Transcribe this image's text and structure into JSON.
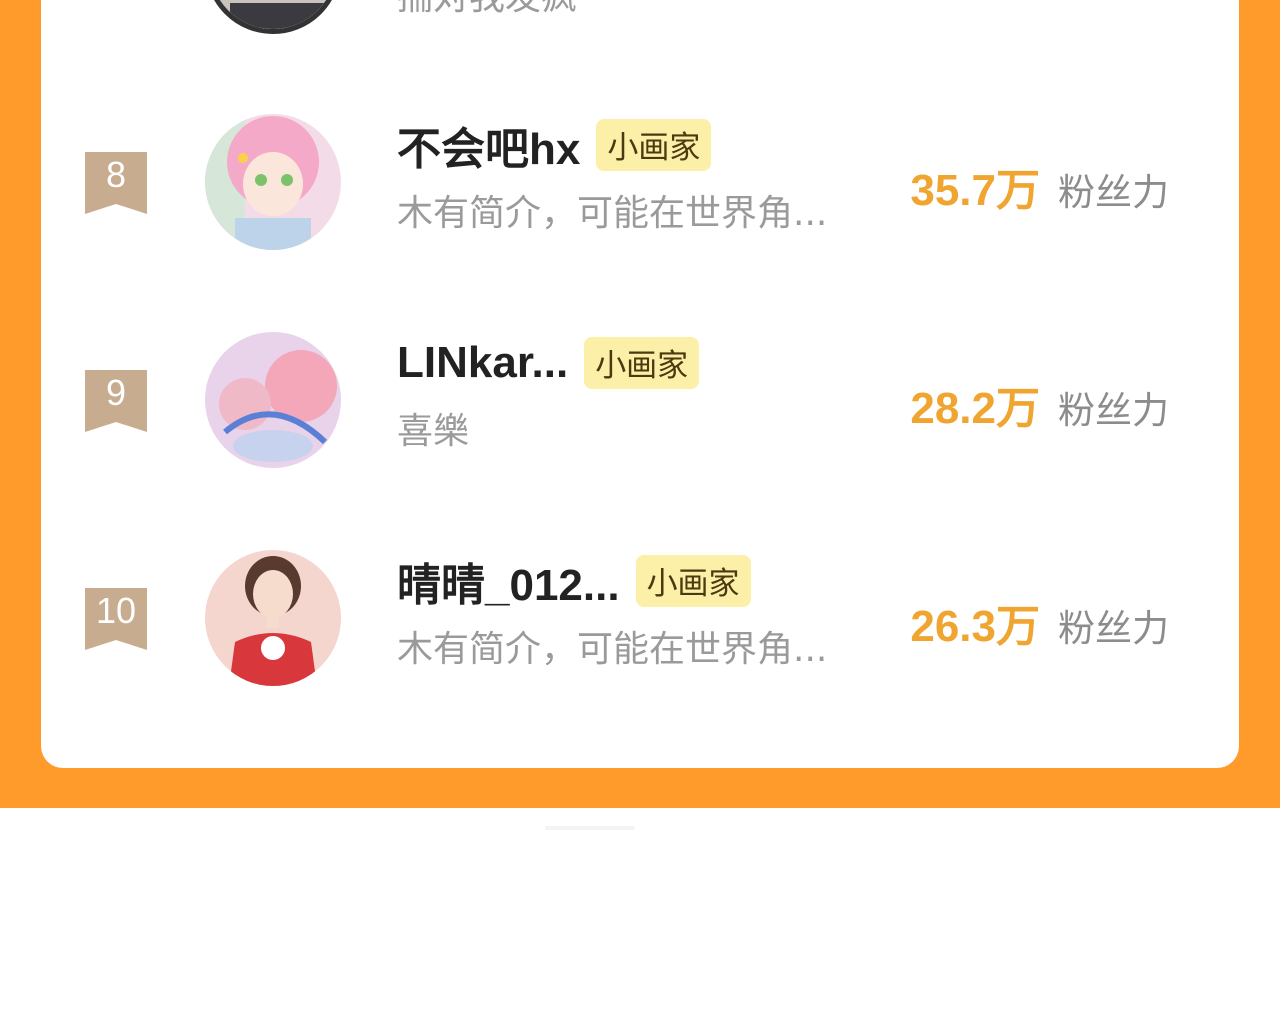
{
  "partial_row": {
    "bio": "揣对我发疯"
  },
  "ranking": [
    {
      "rank": "8",
      "name": "不会吧hx",
      "tag": "小画家",
      "bio": "木有简介，可能在世界角...",
      "score": "35.7万",
      "score_label": "粉丝力"
    },
    {
      "rank": "9",
      "name": "LINkar...",
      "tag": "小画家",
      "bio": "喜樂",
      "score": "28.2万",
      "score_label": "粉丝力"
    },
    {
      "rank": "10",
      "name": "晴晴_012...",
      "tag": "小画家",
      "bio": "木有简介，可能在世界角...",
      "score": "26.3万",
      "score_label": "粉丝力"
    }
  ],
  "colors": {
    "page_background": "#FF9B2A",
    "card_background": "#FFFFFF",
    "score": "#F0A531",
    "tag_background": "#FCEFA8",
    "rank_badge": "#C8AC90"
  },
  "icons": [
    "rank-ribbon-icon",
    "user-avatar"
  ]
}
